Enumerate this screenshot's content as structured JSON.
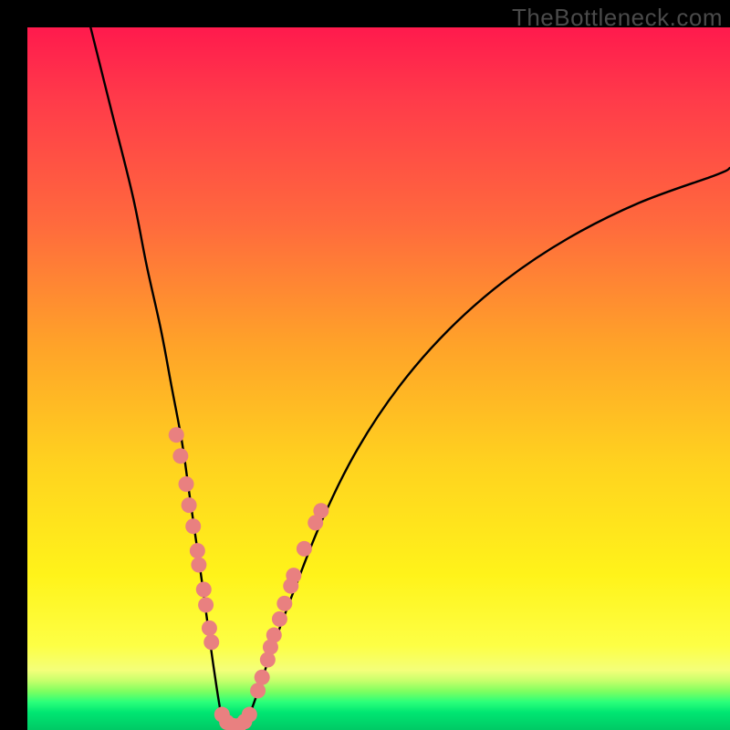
{
  "watermark": "TheBottleneck.com",
  "colors": {
    "curve_stroke": "#000000",
    "dot_fill": "#e98080",
    "frame": "#000000"
  },
  "chart_data": {
    "type": "line",
    "title": "",
    "xlabel": "",
    "ylabel": "",
    "x_range": [
      0,
      100
    ],
    "y_range": [
      0,
      100
    ],
    "note": "No axis ticks or numeric labels are rendered in the image; values below are read off by relative pixel position on a 0–100 normalized scale.",
    "series": [
      {
        "name": "left-branch",
        "x": [
          9,
          12,
          15,
          17,
          19,
          20.5,
          22,
          23,
          24,
          25,
          25.8,
          26.5,
          27.1,
          27.6
        ],
        "y": [
          100,
          88,
          76,
          66,
          57,
          49,
          41,
          34,
          27,
          20,
          14,
          9,
          5,
          2
        ]
      },
      {
        "name": "valley",
        "x": [
          27.6,
          28.3,
          29.0,
          29.8,
          30.6,
          31.5
        ],
        "y": [
          2,
          0.7,
          0.2,
          0.2,
          0.6,
          1.8
        ]
      },
      {
        "name": "right-branch",
        "x": [
          31.5,
          33,
          35,
          38,
          42,
          47,
          53,
          60,
          68,
          77,
          87,
          98,
          100
        ],
        "y": [
          1.8,
          6,
          12,
          20,
          30,
          40,
          49,
          57,
          64,
          70,
          75,
          79,
          80
        ]
      }
    ],
    "marker_clusters": [
      {
        "name": "left-dots",
        "points": [
          {
            "x": 21.2,
            "y": 42
          },
          {
            "x": 21.8,
            "y": 39
          },
          {
            "x": 22.6,
            "y": 35
          },
          {
            "x": 23.0,
            "y": 32
          },
          {
            "x": 23.6,
            "y": 29
          },
          {
            "x": 24.2,
            "y": 25.5
          },
          {
            "x": 24.4,
            "y": 23.5
          },
          {
            "x": 25.1,
            "y": 20
          },
          {
            "x": 25.4,
            "y": 17.8
          },
          {
            "x": 25.9,
            "y": 14.5
          },
          {
            "x": 26.2,
            "y": 12.5
          }
        ]
      },
      {
        "name": "bottom-dots",
        "points": [
          {
            "x": 27.7,
            "y": 2.2
          },
          {
            "x": 28.4,
            "y": 1.1
          },
          {
            "x": 29.3,
            "y": 0.6
          },
          {
            "x": 30.1,
            "y": 0.6
          },
          {
            "x": 30.9,
            "y": 1.2
          },
          {
            "x": 31.6,
            "y": 2.2
          }
        ]
      },
      {
        "name": "right-dots",
        "points": [
          {
            "x": 32.8,
            "y": 5.6
          },
          {
            "x": 33.4,
            "y": 7.5
          },
          {
            "x": 34.2,
            "y": 10
          },
          {
            "x": 34.6,
            "y": 11.8
          },
          {
            "x": 35.1,
            "y": 13.5
          },
          {
            "x": 35.9,
            "y": 15.8
          },
          {
            "x": 36.6,
            "y": 18
          },
          {
            "x": 37.5,
            "y": 20.5
          },
          {
            "x": 37.9,
            "y": 22
          },
          {
            "x": 39.4,
            "y": 25.8
          },
          {
            "x": 41.0,
            "y": 29.5
          },
          {
            "x": 41.8,
            "y": 31.2
          }
        ]
      }
    ]
  }
}
